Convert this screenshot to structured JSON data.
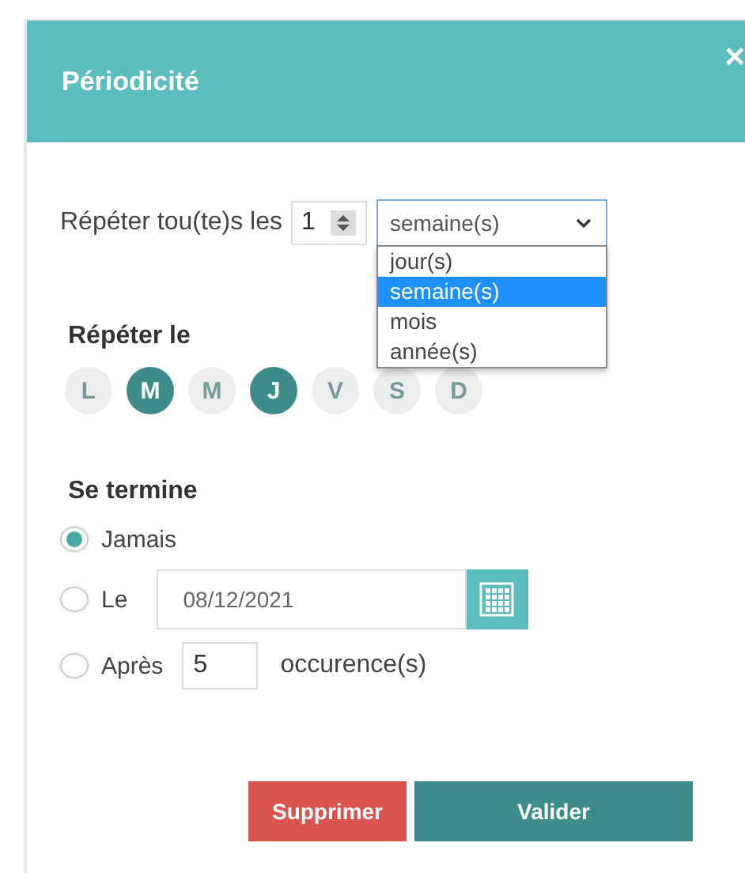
{
  "dialog": {
    "title": "Périodicité",
    "close": "×"
  },
  "repeat": {
    "label": "Répéter tou(te)s les",
    "count": "1",
    "unit": "semaine(s)",
    "dropdown_open": true,
    "options": [
      {
        "label": "jour(s)",
        "selected": false
      },
      {
        "label": "semaine(s)",
        "selected": true
      },
      {
        "label": "mois",
        "selected": false
      },
      {
        "label": "année(s)",
        "selected": false
      }
    ]
  },
  "days": {
    "title": "Répéter le",
    "items": [
      {
        "label": "L",
        "selected": false
      },
      {
        "label": "M",
        "selected": true
      },
      {
        "label": "M",
        "selected": false
      },
      {
        "label": "J",
        "selected": true
      },
      {
        "label": "V",
        "selected": false
      },
      {
        "label": "S",
        "selected": false
      },
      {
        "label": "D",
        "selected": false
      }
    ]
  },
  "end": {
    "title": "Se termine",
    "options": [
      {
        "kind": "never",
        "label": "Jamais",
        "selected": true
      },
      {
        "kind": "date",
        "label": "Le",
        "selected": false,
        "value": "08/12/2021"
      },
      {
        "kind": "count",
        "label": "Après",
        "selected": false,
        "value": "5",
        "suffix": "occurence(s)"
      }
    ]
  },
  "buttons": [
    {
      "kind": "delete",
      "label": "Supprimer"
    },
    {
      "kind": "confirm",
      "label": "Valider"
    }
  ]
}
